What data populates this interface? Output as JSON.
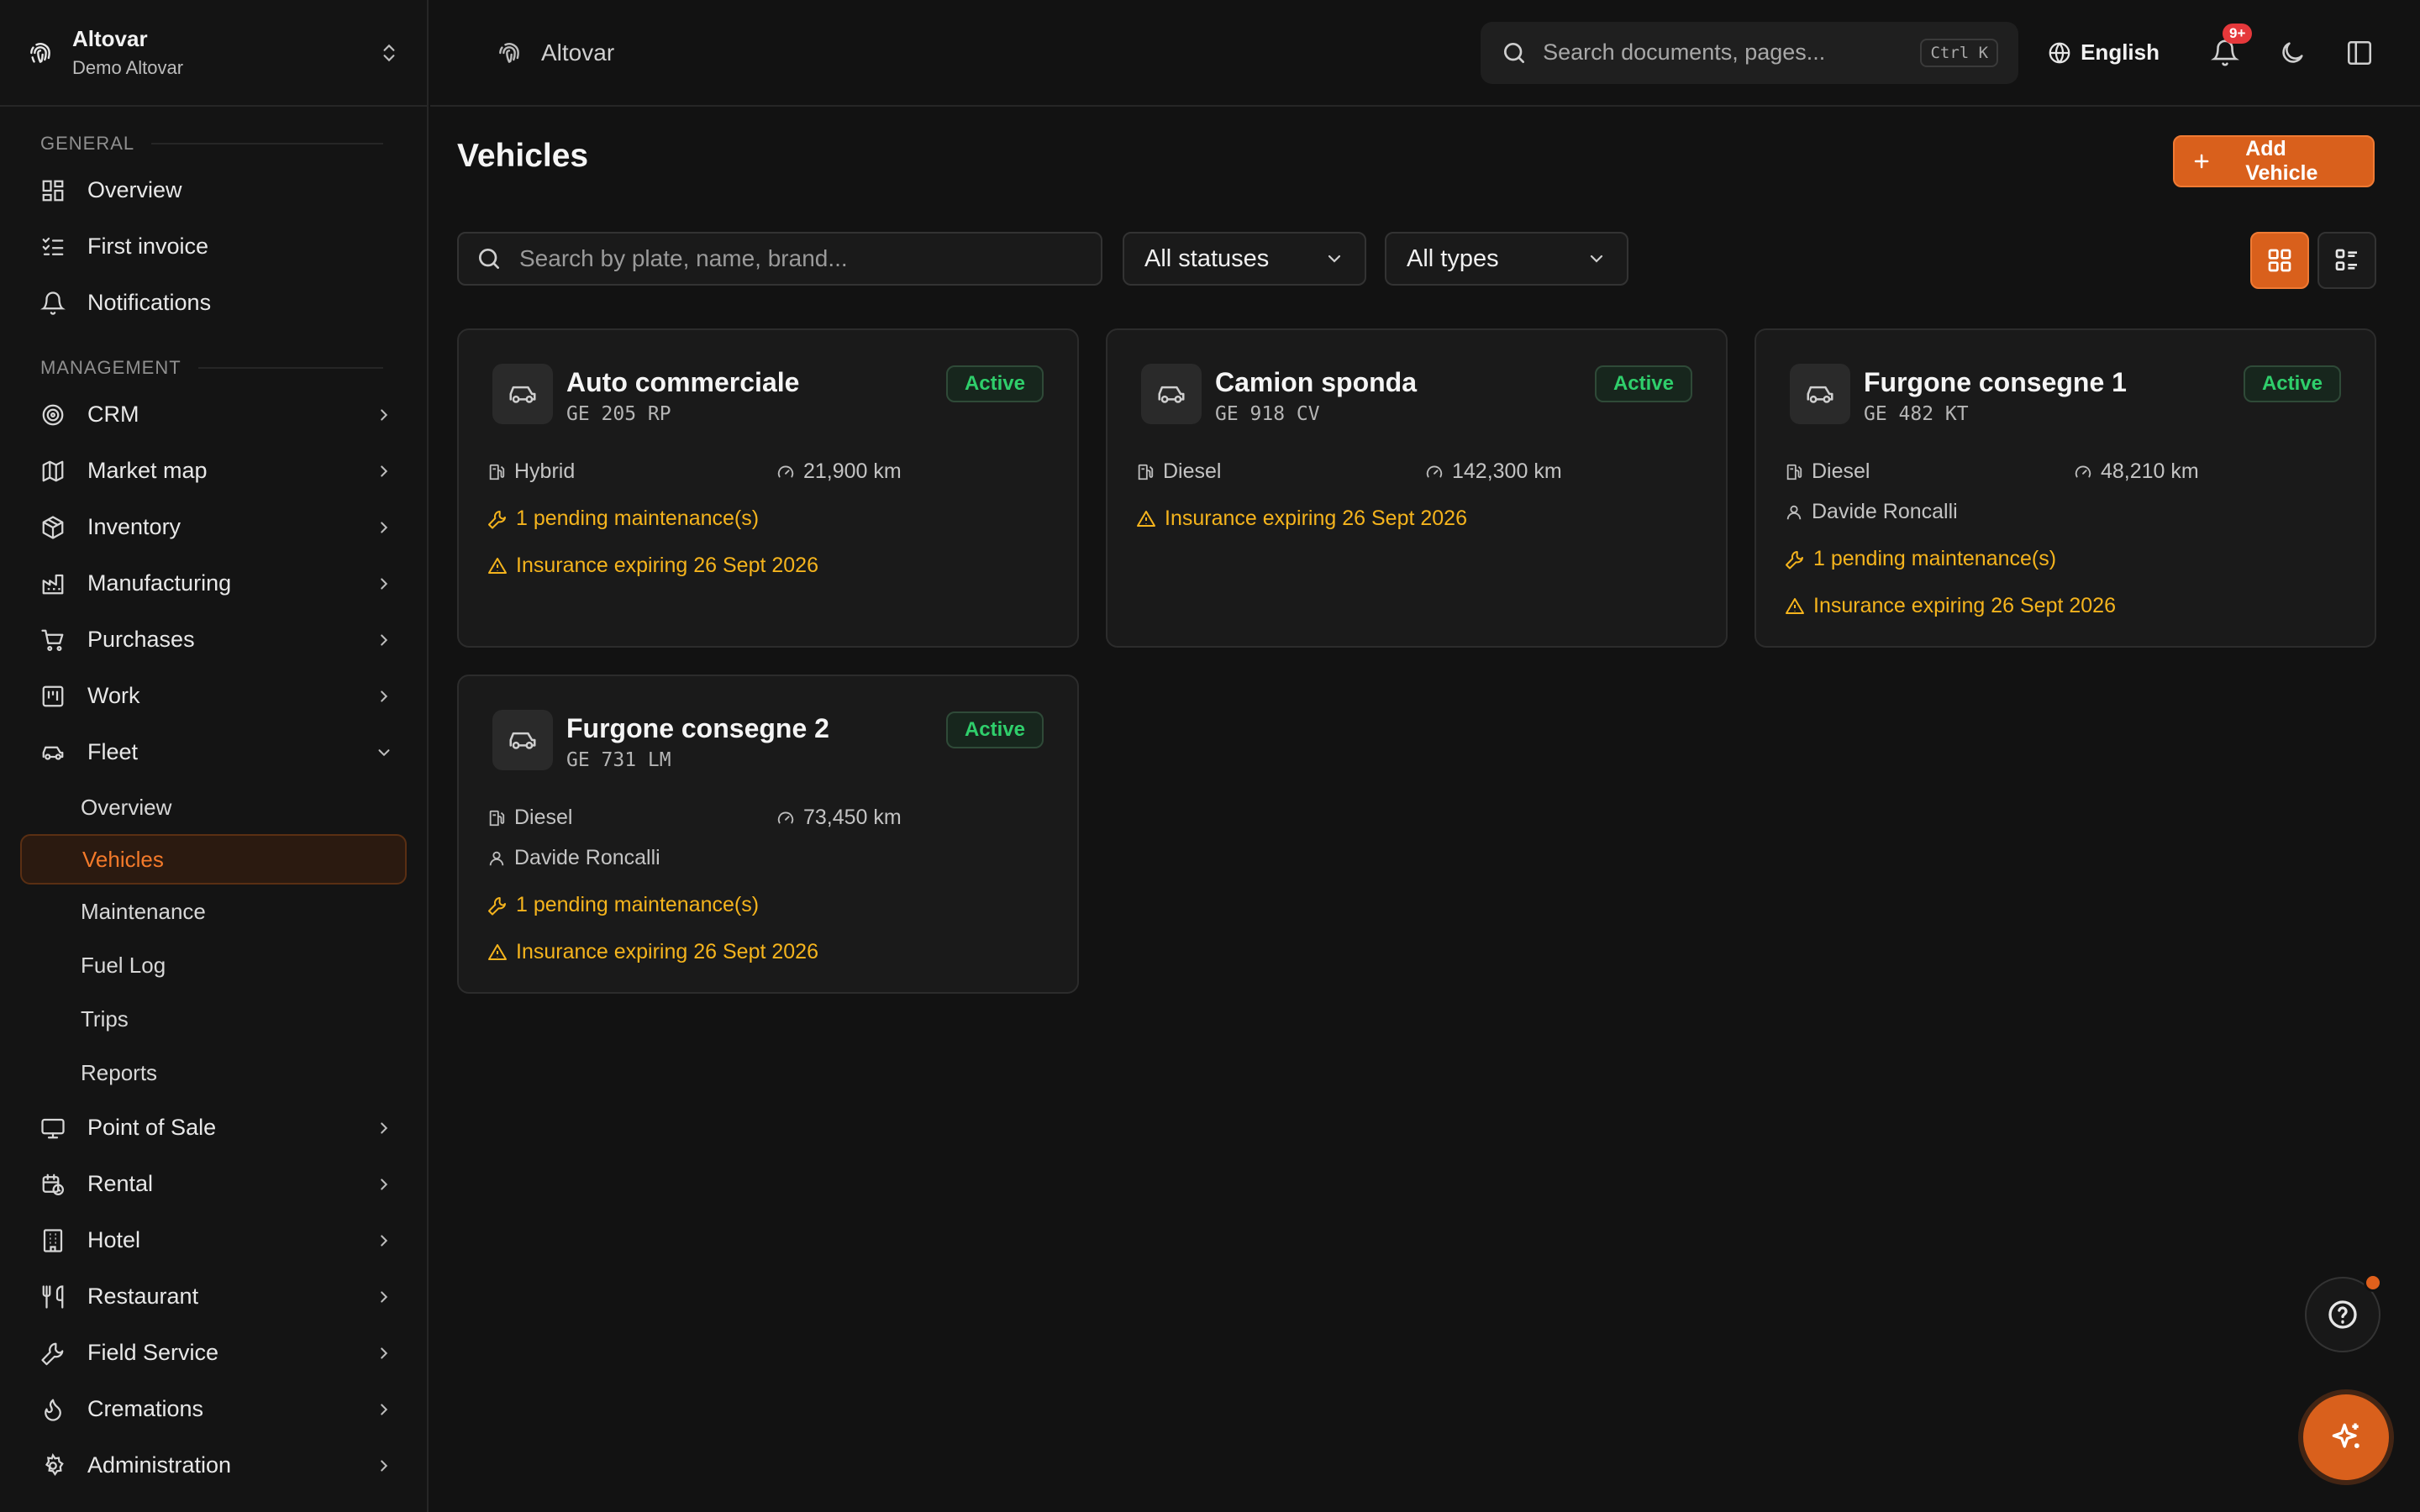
{
  "org": {
    "name": "Altovar",
    "subtitle": "Demo Altovar"
  },
  "sidebar": {
    "general_label": "GENERAL",
    "management_label": "MANAGEMENT",
    "general": [
      {
        "label": "Overview",
        "icon": "layout-dashboard-icon"
      },
      {
        "label": "First invoice",
        "icon": "list-checks-icon"
      },
      {
        "label": "Notifications",
        "icon": "bell-icon"
      }
    ],
    "management": [
      {
        "label": "CRM",
        "icon": "target-icon"
      },
      {
        "label": "Market map",
        "icon": "map-icon"
      },
      {
        "label": "Inventory",
        "icon": "package-icon"
      },
      {
        "label": "Manufacturing",
        "icon": "factory-icon"
      },
      {
        "label": "Purchases",
        "icon": "cart-icon"
      },
      {
        "label": "Work",
        "icon": "kanban-icon"
      },
      {
        "label": "Fleet",
        "icon": "car-icon"
      }
    ],
    "fleet_sub": [
      "Overview",
      "Vehicles",
      "Maintenance",
      "Fuel Log",
      "Trips",
      "Reports"
    ],
    "fleet_active": "Vehicles",
    "more": [
      {
        "label": "Point of Sale",
        "icon": "monitor-icon"
      },
      {
        "label": "Rental",
        "icon": "calendar-clock-icon"
      },
      {
        "label": "Hotel",
        "icon": "building-icon"
      },
      {
        "label": "Restaurant",
        "icon": "utensils-icon"
      },
      {
        "label": "Field Service",
        "icon": "wrench-icon"
      },
      {
        "label": "Cremations",
        "icon": "flame-icon"
      },
      {
        "label": "Administration",
        "icon": "settings-icon"
      }
    ]
  },
  "topbar": {
    "crumb": "Altovar",
    "search_placeholder": "Search documents, pages...",
    "shortcut": "Ctrl K",
    "language": "English",
    "notif_badge": "9+"
  },
  "page": {
    "title": "Vehicles",
    "add_button": "Add Vehicle",
    "search_placeholder": "Search by plate, name, brand...",
    "status_filter": "All statuses",
    "type_filter": "All types"
  },
  "vehicles": [
    {
      "name": "Auto commerciale",
      "plate": "GE 205 RP",
      "status": "Active",
      "fuel": "Hybrid",
      "km": "21,900 km",
      "driver": "",
      "maintenance": "1 pending maintenance(s)",
      "insurance": "Insurance expiring 26 Sept 2026"
    },
    {
      "name": "Camion sponda",
      "plate": "GE 918 CV",
      "status": "Active",
      "fuel": "Diesel",
      "km": "142,300 km",
      "driver": "",
      "maintenance": "",
      "insurance": "Insurance expiring 26 Sept 2026"
    },
    {
      "name": "Furgone consegne 1",
      "plate": "GE 482 KT",
      "status": "Active",
      "fuel": "Diesel",
      "km": "48,210 km",
      "driver": "Davide Roncalli",
      "maintenance": "1 pending maintenance(s)",
      "insurance": "Insurance expiring 26 Sept 2026"
    },
    {
      "name": "Furgone consegne 2",
      "plate": "GE 731 LM",
      "status": "Active",
      "fuel": "Diesel",
      "km": "73,450 km",
      "driver": "Davide Roncalli",
      "maintenance": "1 pending maintenance(s)",
      "insurance": "Insurance expiring 26 Sept 2026"
    }
  ],
  "colors": {
    "accent": "#d9601c",
    "active_green": "#2fce6b",
    "warning": "#f5b41d",
    "background": "#121212"
  }
}
